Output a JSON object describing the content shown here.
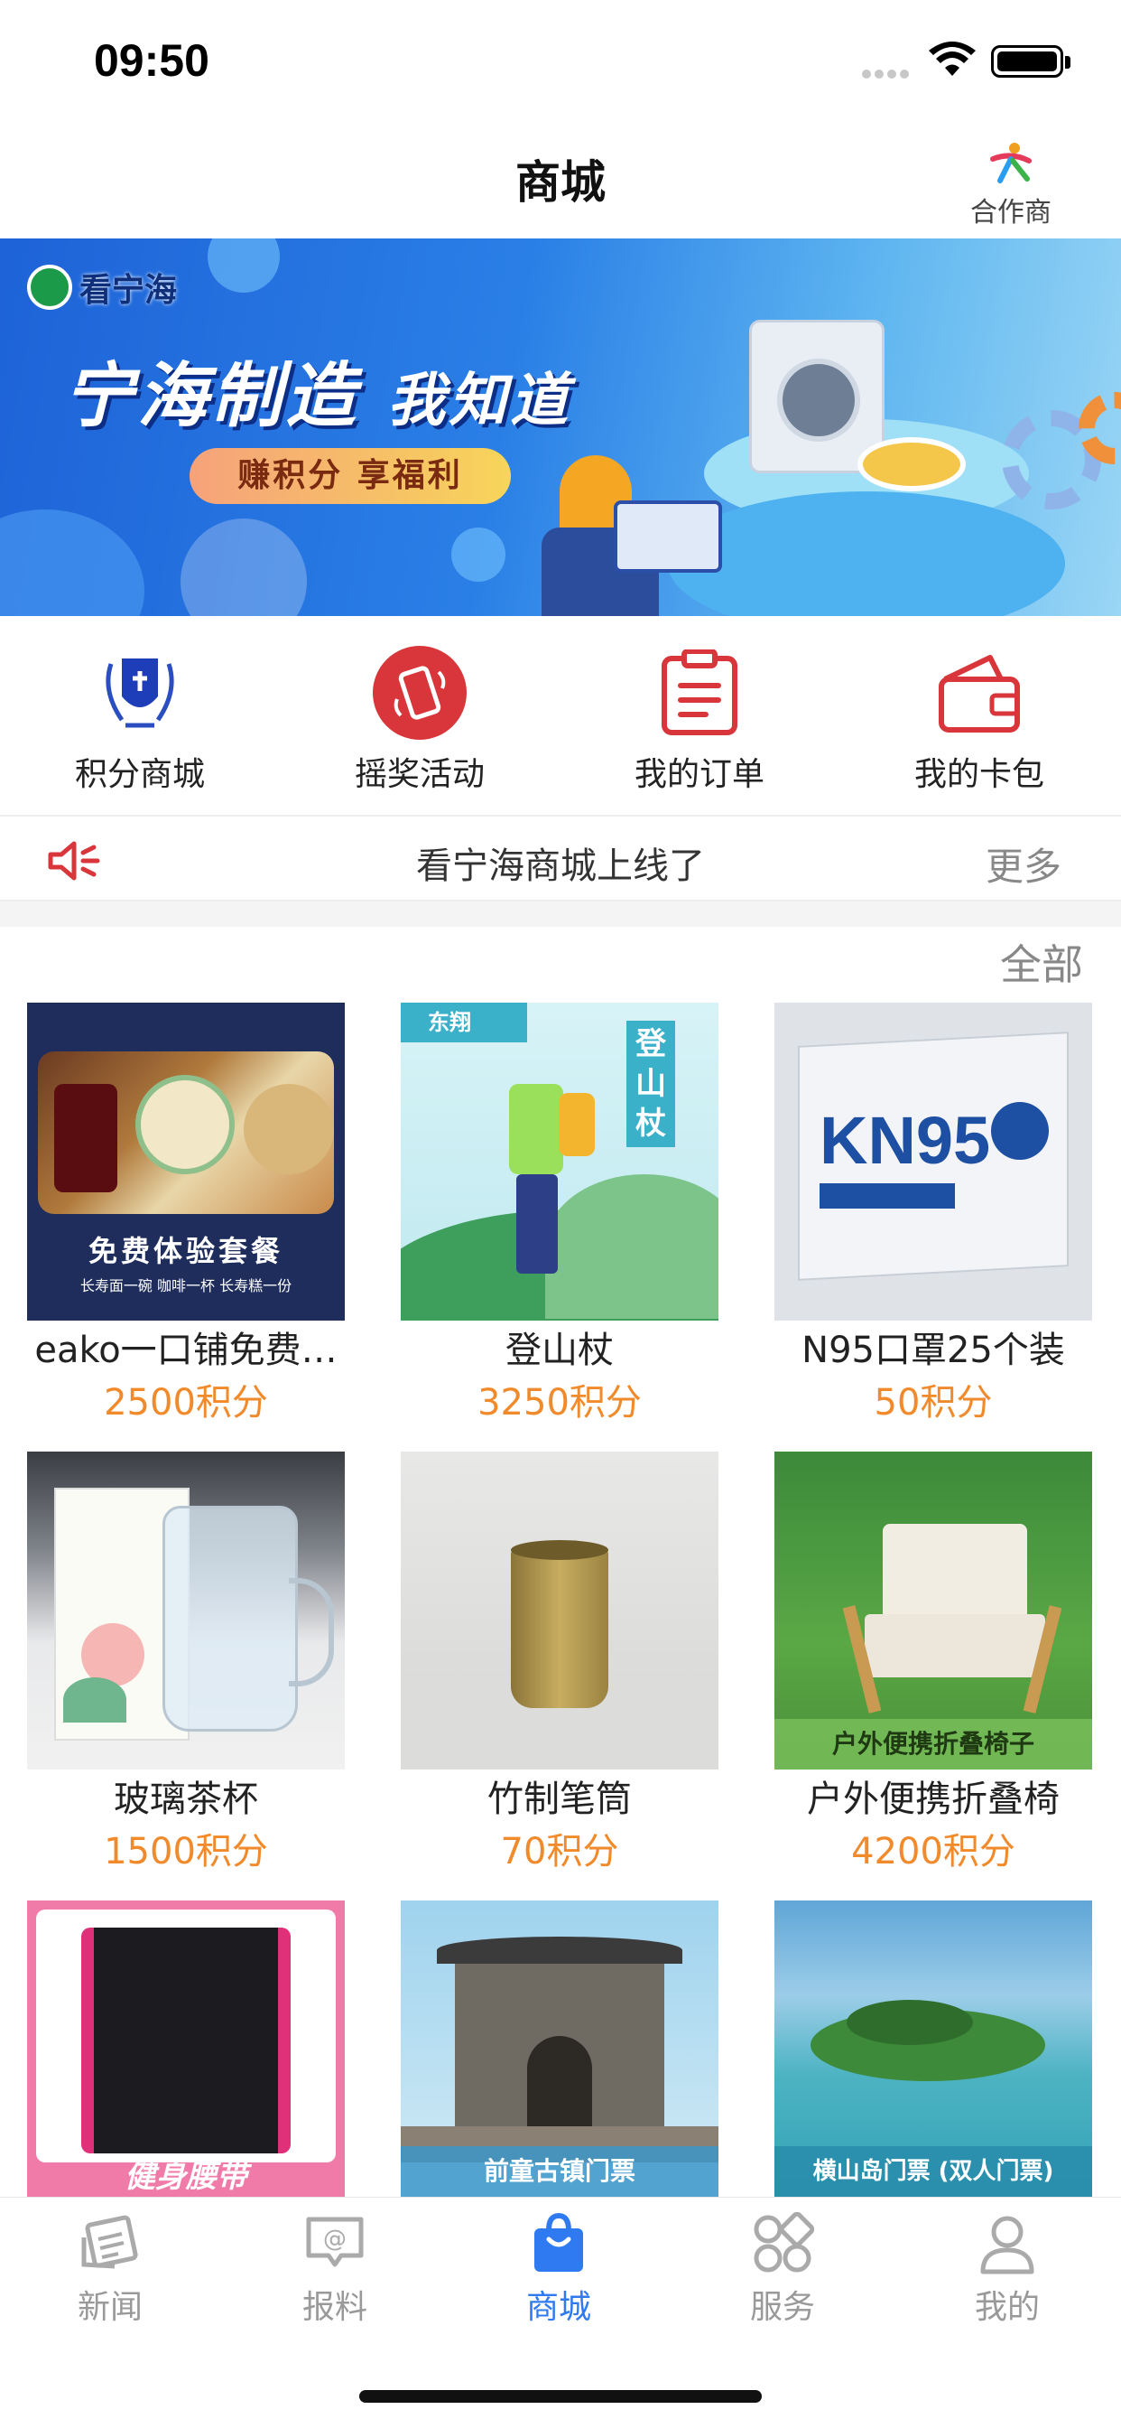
{
  "status_bar": {
    "time": "09:50"
  },
  "nav": {
    "title": "商城",
    "partner_label": "合作商"
  },
  "banner": {
    "logo_text": "看宁海",
    "headline": "宁海制造",
    "headline_sub": "我知道",
    "pill_text": "赚积分 享福利"
  },
  "quick_actions": [
    {
      "label": "积分商城",
      "icon": "points-mall-icon"
    },
    {
      "label": "摇奖活动",
      "icon": "lottery-icon"
    },
    {
      "label": "我的订单",
      "icon": "orders-icon"
    },
    {
      "label": "我的卡包",
      "icon": "wallet-icon"
    }
  ],
  "notice": {
    "text": "看宁海商城上线了",
    "more_label": "更多"
  },
  "section": {
    "all_label": "全部"
  },
  "products": [
    {
      "name": "eako一口铺免费…",
      "price": "2500积分",
      "image_caption": "免费体验套餐",
      "image_sub": "长寿面一碗 咖啡一杯 长寿糕一份"
    },
    {
      "name": "登山杖",
      "price": "3250积分",
      "image_caption": "登山杖",
      "image_brand": "东翔"
    },
    {
      "name": "N95口罩25个装",
      "price": "50积分",
      "image_caption": "KN95"
    },
    {
      "name": "玻璃茶杯",
      "price": "1500积分"
    },
    {
      "name": "竹制笔筒",
      "price": "70积分"
    },
    {
      "name": "户外便携折叠椅",
      "price": "4200积分",
      "image_caption": "户外便携折叠椅子"
    },
    {
      "name": "",
      "price": "",
      "image_caption": "健身腰带"
    },
    {
      "name": "",
      "price": "",
      "image_caption": "前童古镇门票"
    },
    {
      "name": "",
      "price": "",
      "image_caption": "横山岛门票 (双人门票)"
    }
  ],
  "tabbar": {
    "tabs": [
      {
        "label": "新闻",
        "icon": "news-icon",
        "active": false
      },
      {
        "label": "报料",
        "icon": "report-icon",
        "active": false
      },
      {
        "label": "商城",
        "icon": "shop-bag-icon",
        "active": true
      },
      {
        "label": "服务",
        "icon": "services-icon",
        "active": false
      },
      {
        "label": "我的",
        "icon": "profile-icon",
        "active": false
      }
    ]
  },
  "colors": {
    "accent": "#2f7af0",
    "price": "#f08a2b",
    "red_icon": "#d8363a"
  }
}
